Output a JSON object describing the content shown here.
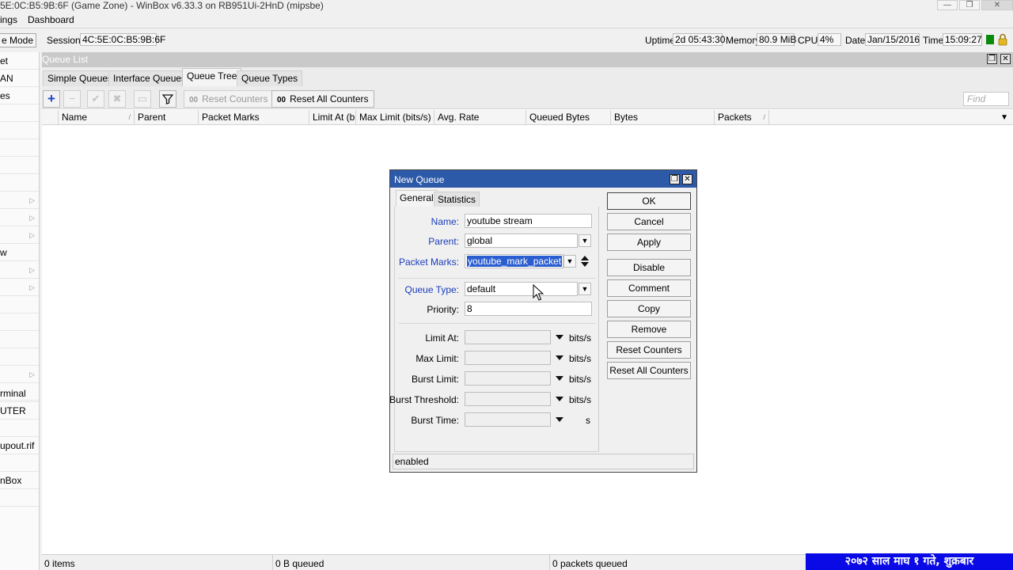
{
  "window": {
    "title": "5E:0C:B5:9B:6F (Game Zone) - WinBox v6.33.3 on RB951Ui-2HnD (mipsbe)",
    "minimize": "—",
    "maximize": "❐",
    "close": "✕"
  },
  "menubar": {
    "settings": "ings",
    "dashboard": "Dashboard"
  },
  "statusbar": {
    "safe_mode": "e Mode",
    "session_label": "Session:",
    "session_value": "4C:5E:0C:B5:9B:6F",
    "uptime_label": "Uptime:",
    "uptime_value": "2d 05:43:30",
    "memory_label": "Memory:",
    "memory_value": "80.9 MiB",
    "cpu_label": "CPU:",
    "cpu_value": "4%",
    "date_label": "Date:",
    "date_value": "Jan/15/2016",
    "time_label": "Time:",
    "time_value": "15:09:27",
    "indicator_color": "#0a8a0a"
  },
  "sidebar": {
    "items": [
      "et",
      "AN",
      "es",
      "",
      "",
      "",
      "",
      "",
      "",
      "w",
      "",
      "",
      "",
      "",
      "",
      "",
      "",
      "",
      "",
      "rminal",
      "UTER",
      "",
      "upout.rif",
      "",
      "nBox",
      ""
    ]
  },
  "queue_list": {
    "title": "Queue List",
    "tabs": [
      "Simple Queues",
      "Interface Queues",
      "Queue Tree",
      "Queue Types"
    ],
    "active_tab": "Queue Tree",
    "toolbar": {
      "add_icon": "+",
      "remove_icon": "−",
      "enable_icon": "✔",
      "disable_icon": "✖",
      "comment_icon": "▭",
      "filter_icon": "filter-icon",
      "reset_counters_prefix": "00",
      "reset_counters": "Reset Counters",
      "reset_all_counters_prefix": "00",
      "reset_all_counters": "Reset All Counters",
      "find_placeholder": "Find"
    },
    "columns": [
      "Name",
      "Parent",
      "Packet Marks",
      "Limit At (b...",
      "Max Limit (bits/s)",
      "Avg. Rate",
      "Queued Bytes",
      "Bytes",
      "Packets"
    ],
    "footer": {
      "items": "0 items",
      "queued": "0 B queued",
      "packets_queued": "0 packets queued"
    }
  },
  "date_banner": "२०७२ साल माघ १ गते, शुक्रबार",
  "dialog": {
    "title": "New Queue",
    "tabs": [
      "General",
      "Statistics"
    ],
    "active_tab": "General",
    "fields": {
      "name_label": "Name:",
      "name_value": "youtube stream",
      "parent_label": "Parent:",
      "parent_value": "global",
      "packet_marks_label": "Packet Marks:",
      "packet_marks_value": "youtube_mark_packet",
      "queue_type_label": "Queue Type:",
      "queue_type_value": "default",
      "priority_label": "Priority:",
      "priority_value": "8",
      "limit_at_label": "Limit At:",
      "max_limit_label": "Max Limit:",
      "burst_limit_label": "Burst Limit:",
      "burst_threshold_label": "Burst Threshold:",
      "burst_time_label": "Burst Time:",
      "unit_bits": "bits/s",
      "unit_seconds": "s"
    },
    "buttons": [
      "OK",
      "Cancel",
      "Apply",
      "Disable",
      "Comment",
      "Copy",
      "Remove",
      "Reset Counters",
      "Reset All Counters"
    ],
    "status": "enabled"
  }
}
